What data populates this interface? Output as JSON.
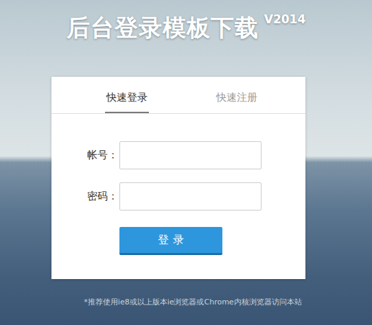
{
  "page": {
    "title": "后台登录模板下载",
    "version": "V2014"
  },
  "tabs": [
    {
      "label": "快速登录",
      "selected": true
    },
    {
      "label": "快速注册",
      "selected": false
    }
  ],
  "fields": [
    {
      "label": "帐号：",
      "value": "",
      "kind": "text"
    },
    {
      "label": "密码：",
      "value": "",
      "kind": "password"
    }
  ],
  "buttons": [
    "登 录"
  ],
  "footer": "*推荐使用ie8或以上版本ie浏览器或Chrome内核浏览器访问本站"
}
